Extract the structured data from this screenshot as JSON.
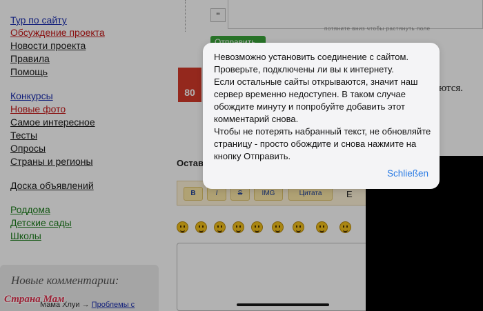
{
  "nav": {
    "group1": [
      "Тур по сайту",
      "Обсуждение проекта",
      "Новости проекта",
      "Правила",
      "Помощь"
    ],
    "group2": [
      "Конкурсы",
      "Новые фото",
      "Самое интересное",
      "Тесты",
      "Опросы",
      "Страны и регионы"
    ],
    "group3": [
      "Доска объявлений"
    ],
    "group4": [
      "Роддома",
      "Детские сады",
      "Школы"
    ]
  },
  "editor": {
    "quote_glyph": "\"",
    "resize_hint": "потяните вниз чтобы растянуть поле",
    "send_label": "Отправить"
  },
  "badge": "80",
  "side_text": "ются.",
  "leave_label": "Остав",
  "toolbar": {
    "bold": "B",
    "italic": "I",
    "strike": "S",
    "img": "IMG",
    "quote": "Цитата",
    "extra": "Е"
  },
  "comments": {
    "title": "Новые комментарии:",
    "logo": "Страна Мам",
    "latest_author": "Мама Хлуи",
    "arrow": "→",
    "latest_link": "Проблемы с"
  },
  "alert": {
    "message": "Невозможно установить соединение с сайтом. Проверьте, подключены ли вы к интернету.\nЕсли остальные сайты открываются, значит наш сервер временно недоступен. В таком случае обождите минуту и попробуйте добавить этот комментарий снова.\nЧтобы не потерять набранный текст, не обновляйте страницу - просто обождите и снова нажмите на кнопку Отправить.",
    "button": "Schließen"
  }
}
